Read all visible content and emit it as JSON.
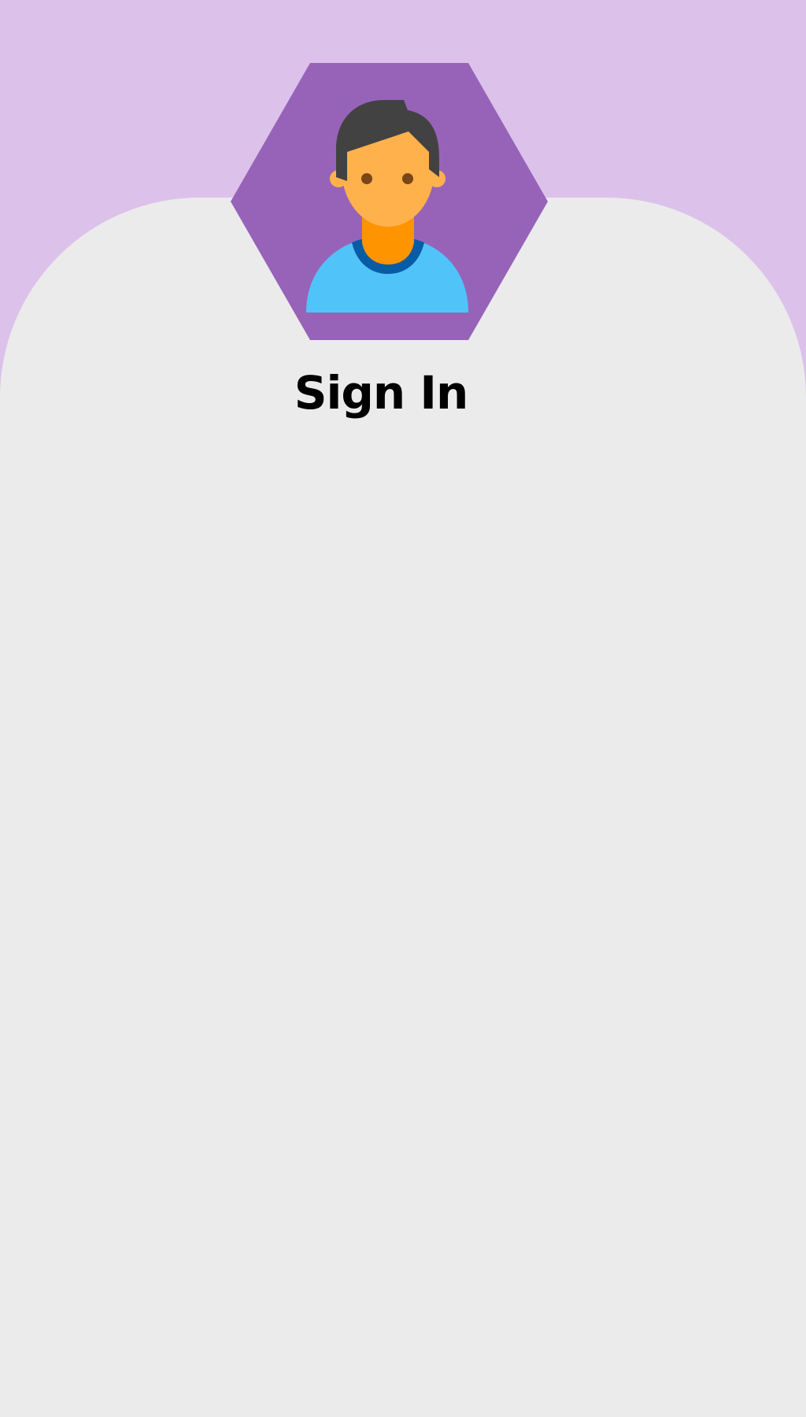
{
  "colors": {
    "background": "#dcc2ea",
    "card": "#ecebec",
    "hexagon": "#9763b8",
    "title_text": "#000000",
    "hair": "#424242",
    "skin": "#ffb14b",
    "neck": "#ff9401",
    "collar": "#085ca6",
    "shirt": "#50c4f9",
    "eyes": "#7a4518"
  },
  "avatar": {
    "icon": "user-avatar-icon"
  },
  "signin": {
    "title": "Sign In"
  }
}
